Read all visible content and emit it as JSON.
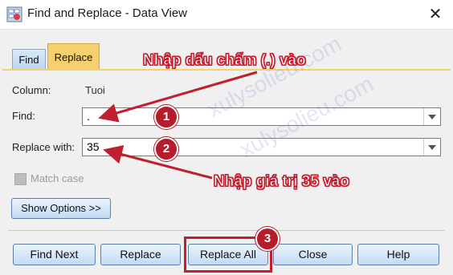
{
  "window": {
    "title": "Find and Replace - Data View",
    "close_glyph": "✕"
  },
  "tabs": [
    {
      "label": "Find",
      "selected": false
    },
    {
      "label": "Replace",
      "selected": true
    }
  ],
  "form": {
    "column_label": "Column:",
    "column_value": "Tuoi",
    "find_label": "Find:",
    "find_value": ".",
    "replace_label": "Replace with:",
    "replace_value": "35",
    "match_case_label": "Match case",
    "show_options_label": "Show Options >>"
  },
  "buttons": {
    "find_next": "Find Next",
    "replace": "Replace",
    "replace_all": "Replace All",
    "close": "Close",
    "help": "Help"
  },
  "annotations": {
    "find_note": "Nhập dấu chấm (.) vào",
    "replace_note": "Nhập giá trị 35 vào",
    "badge1": "1",
    "badge2": "2",
    "badge3": "3",
    "accent_color": "#c01f2f"
  },
  "watermark": "xulysolieu.com"
}
